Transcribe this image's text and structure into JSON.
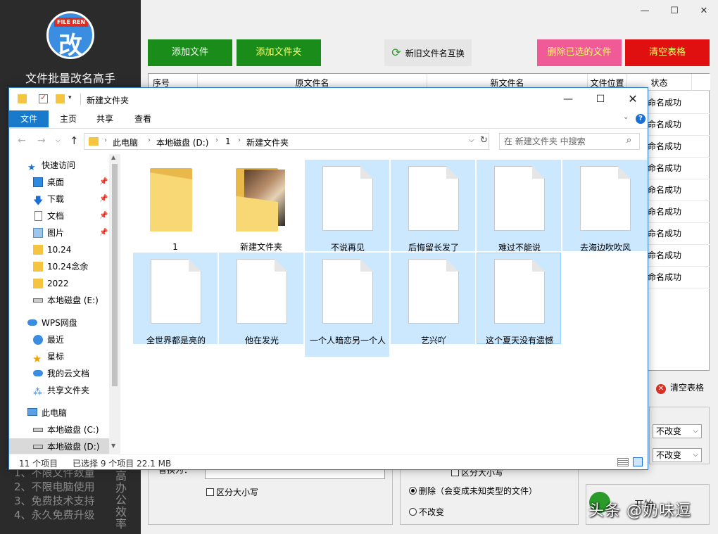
{
  "app": {
    "logo_tag": "FILE REN",
    "logo_glyph": "改",
    "name": "文件批量改名高手",
    "features": [
      "1、不限文件数量",
      "2、不限电脑使用",
      "3、免费技术支持",
      "4、永久免费升级"
    ],
    "vertical_text": "高办公效率",
    "window_buttons": {
      "min": "—",
      "max": "☐",
      "close": "✕"
    },
    "toolbar": {
      "add_file": "添加文件",
      "add_folder": "添加文件夹",
      "swap": "新旧文件名互换",
      "delete_selected": "删除已选的文件",
      "clear_table": "清空表格"
    },
    "grid": {
      "headers": [
        "序号",
        "原文件名",
        "新文件名",
        "文件位置",
        "状态"
      ],
      "status_rows": [
        "命名成功",
        "命名成功",
        "命名成功",
        "命名成功",
        "命名成功",
        "命名成功",
        "命名成功",
        "命名成功",
        "命名成功"
      ]
    },
    "clear_table_2": "清空表格",
    "selects": [
      "不改变",
      "不改变"
    ],
    "replace_label": "替换为：",
    "case_sensitive": "区分大小写",
    "case_sensitive_mid": "区分大小写",
    "radio_delete": "删除（会变成未知类型的文件）",
    "radio_keep": "不改变",
    "start_text": "开始"
  },
  "watermark": "头条 @奶味逗",
  "explorer": {
    "title": "新建文件夹",
    "window_buttons": {
      "min": "—",
      "max": "☐",
      "close": "✕"
    },
    "ribbon_tabs": [
      "文件",
      "主页",
      "共享",
      "查看"
    ],
    "breadcrumb": [
      "此电脑",
      "本地磁盘 (D:)",
      "1",
      "新建文件夹"
    ],
    "search_placeholder": "在 新建文件夹 中搜索",
    "nav_items": [
      {
        "label": "快速访问",
        "icon": "star-icon"
      },
      {
        "label": "桌面",
        "icon": "desktop-icon"
      },
      {
        "label": "下载",
        "icon": "download-icon"
      },
      {
        "label": "文档",
        "icon": "document-icon"
      },
      {
        "label": "图片",
        "icon": "pictures-icon"
      },
      {
        "label": "10.24",
        "icon": "folder-icon"
      },
      {
        "label": "10.24念余",
        "icon": "folder-icon"
      },
      {
        "label": "2022",
        "icon": "folder-icon"
      },
      {
        "label": "本地磁盘 (E:)",
        "icon": "drive-icon"
      },
      {
        "label": "WPS网盘",
        "icon": "cloud-icon"
      },
      {
        "label": "最近",
        "icon": "clock-icon"
      },
      {
        "label": "星标",
        "icon": "star-icon"
      },
      {
        "label": "我的云文档",
        "icon": "cloud-icon"
      },
      {
        "label": "共享文件夹",
        "icon": "share-icon"
      },
      {
        "label": "此电脑",
        "icon": "computer-icon"
      },
      {
        "label": "本地磁盘 (C:)",
        "icon": "drive-icon"
      },
      {
        "label": "本地磁盘 (D:)",
        "icon": "drive-icon"
      }
    ],
    "files": [
      {
        "name": "1",
        "kind": "folder",
        "selected": false
      },
      {
        "name": "新建文件夹",
        "kind": "photo-folder",
        "selected": false
      },
      {
        "name": "不说再见",
        "kind": "file",
        "selected": true
      },
      {
        "name": "后悔留长发了",
        "kind": "file",
        "selected": true
      },
      {
        "name": "难过不能说",
        "kind": "file",
        "selected": true
      },
      {
        "name": "去海边吹吹风",
        "kind": "file",
        "selected": true
      },
      {
        "name": "全世界都是亮的",
        "kind": "file",
        "selected": true
      },
      {
        "name": "他在发光",
        "kind": "file",
        "selected": true
      },
      {
        "name": "一个人暗恋另一个人",
        "kind": "file",
        "selected": true
      },
      {
        "name": "艺兴吖",
        "kind": "file",
        "selected": true
      },
      {
        "name": "这个夏天没有遗憾",
        "kind": "file",
        "selected": true
      }
    ],
    "status_count": "11 个项目",
    "status_selected": "已选择 9 个项目  22.1 MB",
    "colors": {
      "accent": "#1979ca",
      "selection": "#cce8ff"
    }
  }
}
